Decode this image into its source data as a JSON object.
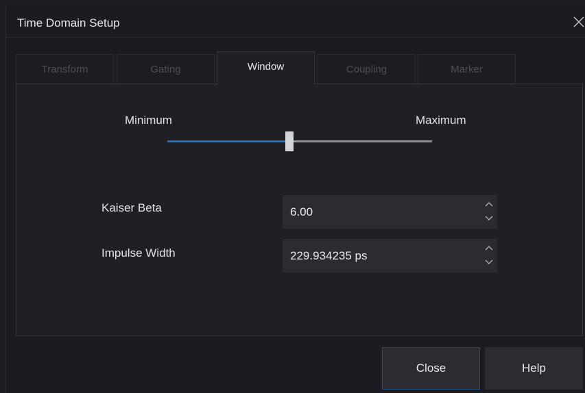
{
  "dialog": {
    "title": "Time Domain Setup",
    "close_icon": "close-icon"
  },
  "tabs": [
    {
      "label": "Transform",
      "active": false
    },
    {
      "label": "Gating",
      "active": false
    },
    {
      "label": "Window",
      "active": true
    },
    {
      "label": "Coupling",
      "active": false
    },
    {
      "label": "Marker",
      "active": false
    }
  ],
  "window_panel": {
    "slider": {
      "min_label": "Minimum",
      "max_label": "Maximum",
      "value_fraction": 0.46
    },
    "fields": [
      {
        "label": "Kaiser Beta",
        "value": "6.00"
      },
      {
        "label": "Impulse Width",
        "value": "229.934235 ps"
      }
    ]
  },
  "footer": {
    "close_label": "Close",
    "help_label": "Help"
  },
  "colors": {
    "accent": "#1f6fc3",
    "background": "#1a1c21",
    "field": "#2a2c31",
    "text": "#e6e7ea",
    "inactive_text": "#4b4e55"
  }
}
